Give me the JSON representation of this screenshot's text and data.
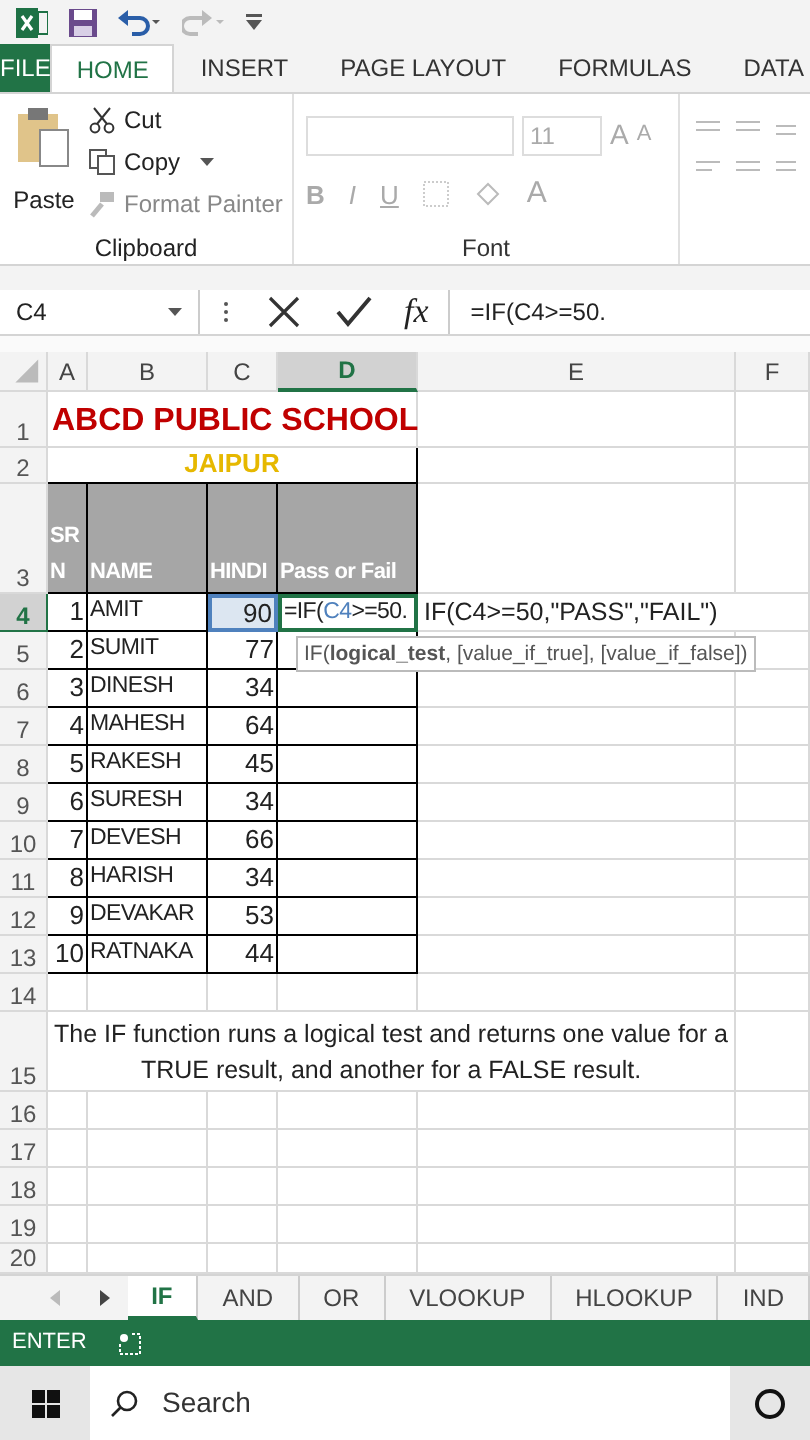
{
  "ribbon": {
    "tabs": [
      {
        "label": "FILE",
        "kind": "file",
        "selected": false
      },
      {
        "label": "HOME",
        "kind": "tab",
        "selected": true
      },
      {
        "label": "INSERT",
        "kind": "tab",
        "selected": false
      },
      {
        "label": "PAGE LAYOUT",
        "kind": "tab",
        "selected": false
      },
      {
        "label": "FORMULAS",
        "kind": "tab",
        "selected": false
      },
      {
        "label": "DATA",
        "kind": "tab",
        "selected": false
      }
    ],
    "clipboard": {
      "paste": "Paste",
      "cut": "Cut",
      "copy": "Copy",
      "format_painter": "Format Painter",
      "label": "Clipboard"
    },
    "font": {
      "size": "11",
      "grow": "A",
      "shrink": "A",
      "bold": "B",
      "italic": "I",
      "underline": "U",
      "font_color_label": "A",
      "label": "Font"
    }
  },
  "formula_bar": {
    "name_box": "C4",
    "insert_function": "fx",
    "formula": "=IF(C4>=50."
  },
  "sheet": {
    "columns": [
      {
        "label": "A",
        "selected": false
      },
      {
        "label": "B",
        "selected": false
      },
      {
        "label": "C",
        "selected": false
      },
      {
        "label": "D",
        "selected": true
      },
      {
        "label": "E",
        "selected": false
      },
      {
        "label": "F",
        "selected": false
      }
    ],
    "rows": [
      {
        "label": "1",
        "selected": false
      },
      {
        "label": "2",
        "selected": false
      },
      {
        "label": "3",
        "selected": false
      },
      {
        "label": "4",
        "selected": true
      },
      {
        "label": "5",
        "selected": false
      },
      {
        "label": "6",
        "selected": false
      },
      {
        "label": "7",
        "selected": false
      },
      {
        "label": "8",
        "selected": false
      },
      {
        "label": "9",
        "selected": false
      },
      {
        "label": "10",
        "selected": false
      },
      {
        "label": "11",
        "selected": false
      },
      {
        "label": "12",
        "selected": false
      },
      {
        "label": "13",
        "selected": false
      },
      {
        "label": "14",
        "selected": false
      },
      {
        "label": "15",
        "selected": false
      },
      {
        "label": "16",
        "selected": false
      },
      {
        "label": "17",
        "selected": false
      },
      {
        "label": "18",
        "selected": false
      },
      {
        "label": "19",
        "selected": false
      },
      {
        "label": "20",
        "selected": false
      }
    ],
    "title": "ABCD PUBLIC SCHOOL",
    "subtitle": "JAIPUR",
    "headers": [
      "SR N",
      "NAME",
      "HINDI",
      "Pass or Fail"
    ],
    "records": [
      {
        "sr": "1",
        "name": "AMIT",
        "hindi": "90"
      },
      {
        "sr": "2",
        "name": "SUMIT",
        "hindi": "77"
      },
      {
        "sr": "3",
        "name": "DINESH",
        "hindi": "34"
      },
      {
        "sr": "4",
        "name": "MAHESH",
        "hindi": "64"
      },
      {
        "sr": "5",
        "name": "RAKESH",
        "hindi": "45"
      },
      {
        "sr": "6",
        "name": "SURESH",
        "hindi": "34"
      },
      {
        "sr": "7",
        "name": "DEVESH",
        "hindi": "66"
      },
      {
        "sr": "8",
        "name": "HARISH",
        "hindi": "34"
      },
      {
        "sr": "9",
        "name": "DEVAKAR",
        "hindi": "53"
      },
      {
        "sr": "10",
        "name": "RATNAKA",
        "hindi": "44"
      }
    ],
    "editing": {
      "before": "=IF(",
      "ref": "C4",
      "after": ">=50."
    },
    "overflow": "IF(C4>=50,\"PASS\",\"FAIL\")",
    "tooltip": "IF(**logical_test**, [value_if_true], [value_if_false])",
    "note": "The IF function runs a logical test and returns one value for a TRUE result, and another for a FALSE result."
  },
  "sheet_tabs": [
    {
      "label": "IF",
      "selected": true
    },
    {
      "label": "AND",
      "selected": false
    },
    {
      "label": "OR",
      "selected": false
    },
    {
      "label": "VLOOKUP",
      "selected": false
    },
    {
      "label": "HLOOKUP",
      "selected": false
    },
    {
      "label": "IND",
      "selected": false
    }
  ],
  "status_bar": {
    "mode": "ENTER"
  },
  "taskbar": {
    "search_placeholder": "Search"
  }
}
